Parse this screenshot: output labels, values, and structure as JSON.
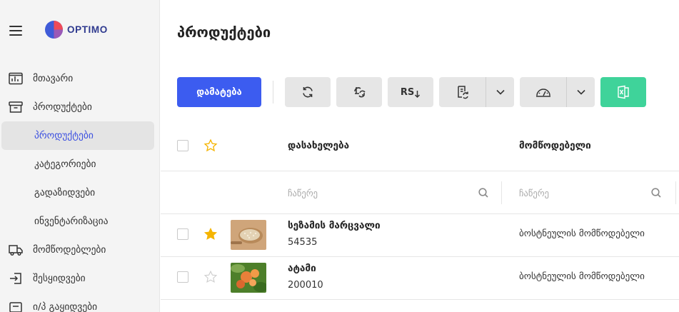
{
  "app": {
    "brand": "OPTIMO"
  },
  "sidebar": {
    "items": [
      {
        "label": "მთავარი",
        "icon": "dashboard-icon"
      },
      {
        "label": "პროდუქტები",
        "icon": "box-icon"
      },
      {
        "label": "პროდუქტები",
        "active": true
      },
      {
        "label": "კატეგორიები"
      },
      {
        "label": "გადაზიდვები"
      },
      {
        "label": "ინვენტარიზაცია"
      },
      {
        "label": "მომწოდებლები",
        "icon": "truck-icon"
      },
      {
        "label": "შესყიდვები",
        "icon": "login-icon"
      },
      {
        "label": "ი/პ გაყიდვები",
        "icon": "sales-icon"
      }
    ]
  },
  "page": {
    "title": "პროდუქტები"
  },
  "toolbar": {
    "add_label": "დამატება",
    "rs_label": "RS",
    "buttons": [
      "refresh-icon",
      "sync-price-icon",
      "rs-download-icon",
      "document-sync-icon",
      "scale-icon",
      "excel-icon"
    ]
  },
  "colors": {
    "primary": "#3c5cf0",
    "excel": "#3fd39a",
    "star": "#f5b400",
    "active_text": "#3c50e0"
  },
  "table": {
    "columns": [
      "დასახელება",
      "მომწოდებელი"
    ],
    "filter_placeholder": "ჩაწერე",
    "rows": [
      {
        "name": "სეზამის მარცვალი",
        "code": "54535",
        "supplier": "ბოსტნეულის მომწოდებელი",
        "favorite": true
      },
      {
        "name": "ატამი",
        "code": "200010",
        "supplier": "ბოსტნეულის მომწოდებელი",
        "favorite": false
      }
    ]
  }
}
